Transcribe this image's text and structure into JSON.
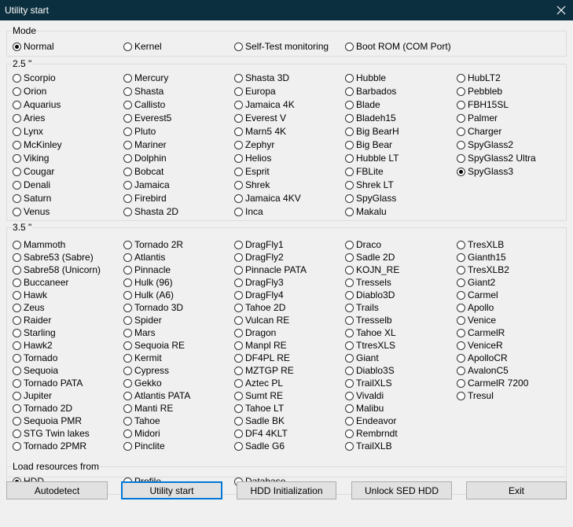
{
  "window": {
    "title": "Utility start"
  },
  "mode": {
    "label": "Mode",
    "options": [
      "Normal",
      "Kernel",
      "Self-Test monitoring",
      "Boot ROM (COM Port)"
    ],
    "selected": 0
  },
  "group25": {
    "label": "2.5 \"",
    "columns": [
      [
        "Scorpio",
        "Orion",
        "Aquarius",
        "Aries",
        "Lynx",
        "McKinley",
        "Viking",
        "Cougar",
        "Denali",
        "Saturn",
        "Venus"
      ],
      [
        "Mercury",
        "Shasta",
        "Callisto",
        "Everest5",
        "Pluto",
        "Mariner",
        "Dolphin",
        "Bobcat",
        "Jamaica",
        "Firebird",
        "Shasta 2D"
      ],
      [
        "Shasta 3D",
        "Europa",
        "Jamaica 4K",
        "Everest V",
        "Marn5 4K",
        "Zephyr",
        "Helios",
        "Esprit",
        "Shrek",
        "Jamaica 4KV",
        "Inca"
      ],
      [
        "Hubble",
        "Barbados",
        "Blade",
        "Bladeh15",
        "Big BearH",
        "Big Bear",
        "Hubble LT",
        "FBLite",
        "Shrek LT",
        "SpyGlass",
        "Makalu"
      ],
      [
        "HubLT2",
        "Pebbleb",
        "FBH15SL",
        "Palmer",
        "Charger",
        "SpyGlass2",
        "SpyGlass2 Ultra",
        "SpyGlass3"
      ]
    ],
    "selected": "SpyGlass3"
  },
  "group35": {
    "label": "3.5 \"",
    "columns": [
      [
        "Mammoth",
        "Sabre53 (Sabre)",
        "Sabre58 (Unicorn)",
        "Buccaneer",
        "Hawk",
        "Zeus",
        "Raider",
        "Starling",
        "Hawk2",
        "Tornado",
        "Sequoia",
        "Tornado PATA",
        "Jupiter",
        "Tornado 2D",
        "Sequoia PMR",
        "STG Twin lakes",
        "Tornado 2PMR"
      ],
      [
        "Tornado 2R",
        "Atlantis",
        "Pinnacle",
        "Hulk (96)",
        "Hulk (A6)",
        "Tornado 3D",
        "Spider",
        "Mars",
        "Sequoia RE",
        "Kermit",
        "Cypress",
        "Gekko",
        "Atlantis PATA",
        "Manti RE",
        "Tahoe",
        "Midori",
        "Pinclite"
      ],
      [
        "DragFly1",
        "DragFly2",
        "Pinnacle PATA",
        "DragFly3",
        "DragFly4",
        "Tahoe 2D",
        "Vulcan RE",
        "Dragon",
        "Manpl RE",
        "DF4PL RE",
        "MZTGP RE",
        "Aztec PL",
        "Sumt RE",
        "Tahoe LT",
        "Sadle BK",
        "DF4 4KLT",
        "Sadle G6"
      ],
      [
        "Draco",
        "Sadle 2D",
        "KOJN_RE",
        "Tressels",
        "Diablo3D",
        "Trails",
        "Tresselb",
        "Tahoe XL",
        "TtresXLS",
        "Giant",
        "Diablo3S",
        "TrailXLS",
        "Vivaldi",
        "Malibu",
        "Endeavor",
        "Rembrndt",
        "TrailXLB"
      ],
      [
        "TresXLB",
        "Gianth15",
        "TresXLB2",
        "Giant2",
        "Carmel",
        "Apollo",
        "Venice",
        "CarmelR",
        "VeniceR",
        "ApolloCR",
        "AvalonC5",
        "CarmelR 7200",
        "Tresul"
      ]
    ],
    "selected": null
  },
  "load": {
    "label": "Load resources from",
    "options": [
      "HDD",
      "Profile",
      "Database"
    ],
    "selected": 0
  },
  "buttons": [
    "Autodetect",
    "Utility start",
    "HDD Initialization",
    "Unlock SED HDD",
    "Exit"
  ],
  "default_button": 1
}
